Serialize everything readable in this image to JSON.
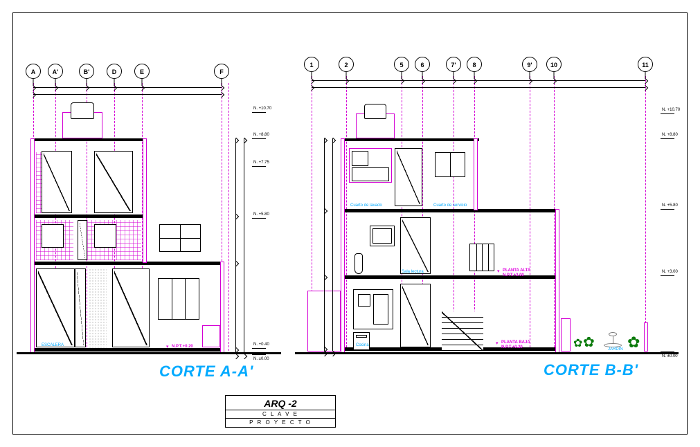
{
  "sheet": {
    "code": "ARQ -2",
    "clave": "C L A V E",
    "proyecto": "P R O Y E C T O"
  },
  "section_a": {
    "title": "CORTE  A-A'",
    "grid_labels": [
      "A",
      "A'",
      "B'",
      "D",
      "E",
      "F"
    ],
    "room_labels": [
      "ESCALERA"
    ],
    "npt": "N.P.T.+0.20",
    "levels": [
      "N. +10.70",
      "N. +8.80",
      "N. +7.75",
      "N. +5.80",
      "N. +0.40",
      "N. ±0.00"
    ]
  },
  "section_b": {
    "title": "CORTE B-B'",
    "grid_labels": [
      "1",
      "2",
      "5",
      "6",
      "7'",
      "8",
      "9'",
      "10",
      "11"
    ],
    "room_labels": {
      "cto_lavado": "Cuarto de lavado",
      "cto_servicio": "Cuarto de servicio",
      "sala_lectura": "Sala lectura",
      "pl_alta": "PLANTA ALTA",
      "pl_baja": "PLANTA BAJA",
      "cocina": "Cocina",
      "jardin": "JARDIN"
    },
    "npt_upper": "N.P.T.+3.00",
    "npt_lower": "N.P.T.+0.20",
    "levels": [
      "N. +10.70",
      "N. +8.80",
      "N. +5.80",
      "N. +3.00",
      "N. ±0.00"
    ]
  }
}
